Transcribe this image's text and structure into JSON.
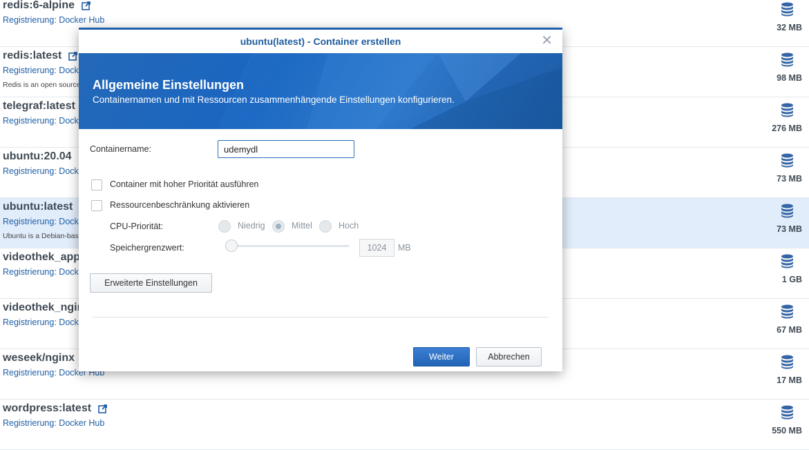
{
  "image_list": [
    {
      "name": "redis:6-alpine",
      "registry": "Registrierung: Docker Hub",
      "description": "",
      "size": "32 MB",
      "external_link": true,
      "selected": false
    },
    {
      "name": "redis:latest",
      "registry": "Registrierung: Docker Hub",
      "description": "Redis is an open source key-value store that functions as a data structure server.",
      "size": "98 MB",
      "external_link": true,
      "selected": false
    },
    {
      "name": "telegraf:latest",
      "registry": "Registrierung: Docker Hub",
      "description": "",
      "size": "276 MB",
      "external_link": true,
      "selected": false
    },
    {
      "name": "ubuntu:20.04",
      "registry": "Registrierung: Docker Hub",
      "description": "",
      "size": "73 MB",
      "external_link": true,
      "selected": false
    },
    {
      "name": "ubuntu:latest",
      "registry": "Registrierung: Docker Hub",
      "description": "Ubuntu is a Debian-based Linux operating system based on free software.",
      "size": "73 MB",
      "external_link": true,
      "selected": true
    },
    {
      "name": "videothek_app",
      "registry": "Registrierung: Docker Hub",
      "description": "",
      "size": "1 GB",
      "external_link": true,
      "selected": false
    },
    {
      "name": "videothek_nginx",
      "registry": "Registrierung: Docker Hub",
      "description": "",
      "size": "67 MB",
      "external_link": true,
      "selected": false
    },
    {
      "name": "weseek/nginx",
      "registry": "Registrierung: Docker Hub",
      "description": "",
      "size": "17 MB",
      "external_link": true,
      "selected": false
    },
    {
      "name": "wordpress:latest",
      "registry": "Registrierung: Docker Hub",
      "description": "",
      "size": "550 MB",
      "external_link": true,
      "selected": false
    }
  ],
  "modal": {
    "title": "ubuntu(latest) - Container erstellen",
    "close_icon": "close-icon",
    "banner": {
      "title": "Allgemeine Einstellungen",
      "subtitle": "Containernamen und mit Ressourcen zusammenhängende Einstellungen konfigurieren."
    },
    "container_name": {
      "label": "Containername:",
      "value": "udemydl"
    },
    "high_priority": {
      "label": "Container mit hoher Priorität ausführen",
      "checked": false
    },
    "resource_limit": {
      "label": "Ressourcenbeschränkung aktivieren",
      "checked": false
    },
    "cpu_priority": {
      "label": "CPU-Priorität:",
      "options": [
        "Niedrig",
        "Mittel",
        "Hoch"
      ],
      "selected": "Mittel",
      "disabled": true
    },
    "memory_limit": {
      "label": "Speichergrenzwert:",
      "value": "1024",
      "unit": "MB",
      "disabled": true
    },
    "advanced_button": "Erweiterte Einstellungen",
    "next_button": "Weiter",
    "cancel_button": "Abbrechen"
  },
  "colors": {
    "accent": "#1d5fa8",
    "link": "#1f5fa6",
    "selected_row": "#e2edfb",
    "primary_button": "#2264b6"
  },
  "icons": {
    "size_icon": "database-icon",
    "external_link_icon": "external-link-icon"
  }
}
